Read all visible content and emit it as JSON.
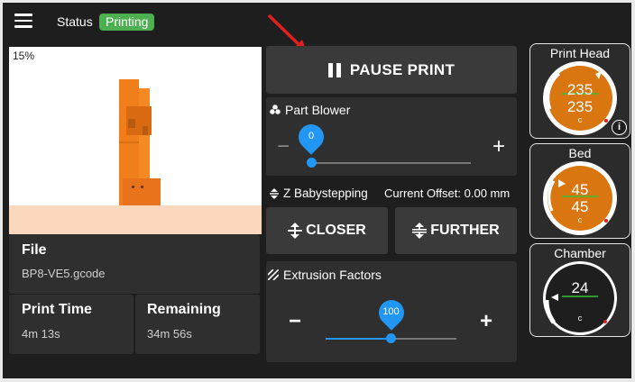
{
  "header": {
    "status_label": "Status",
    "status_badge": "Printing",
    "badge_color": "#4caf50"
  },
  "preview": {
    "progress": "15%",
    "part_color": "#f07f1b",
    "floor_color": "#fbd7bd"
  },
  "file": {
    "title": "File",
    "name": "BP8-VE5.gcode"
  },
  "print_time": {
    "title": "Print Time",
    "value": "4m 13s"
  },
  "remaining": {
    "title": "Remaining",
    "value": "34m 56s"
  },
  "pause": {
    "label": "PAUSE PRINT"
  },
  "part_blower": {
    "title": "Part Blower",
    "value": "0",
    "minus": "−",
    "plus": "+",
    "fraction": 0
  },
  "babystep": {
    "title": "Z Babystepping",
    "offset_label": "Current Offset: 0.00 mm",
    "closer_label": "CLOSER",
    "further_label": "FURTHER"
  },
  "extrusion": {
    "title": "Extrusion Factors",
    "value": "100",
    "minus": "−",
    "plus": "+",
    "fraction": 0.5
  },
  "gauges": {
    "head": {
      "title": "Print Head",
      "actual": "235",
      "target": "235",
      "unit": "c",
      "fill": "#d9760f",
      "info_icon": "i"
    },
    "bed": {
      "title": "Bed",
      "actual": "45",
      "target": "45",
      "unit": "c",
      "fill": "#d9760f"
    },
    "chamber": {
      "title": "Chamber",
      "actual": "24",
      "unit": "c",
      "fill": "#1e1e1e"
    }
  },
  "accent": "#2196f3"
}
